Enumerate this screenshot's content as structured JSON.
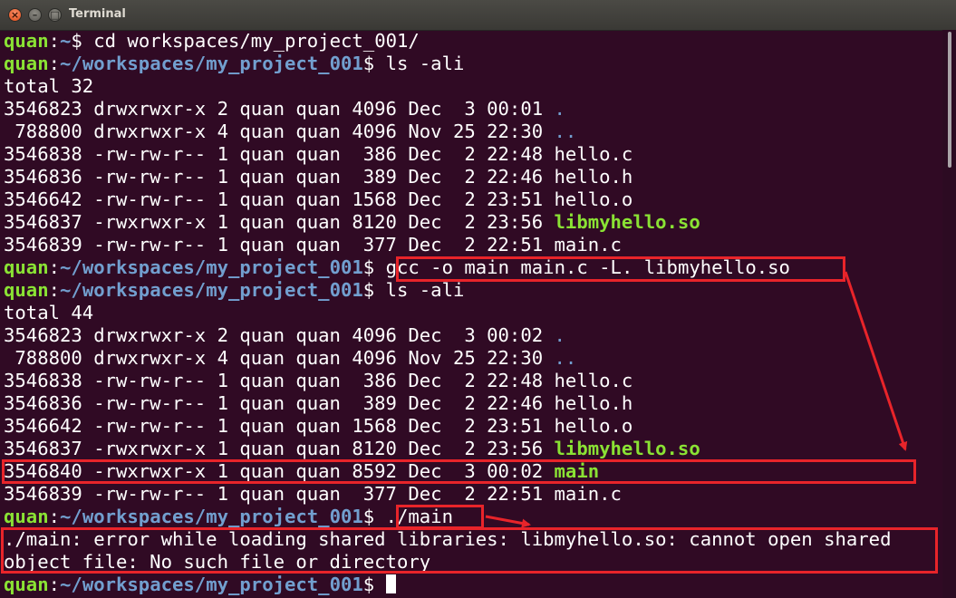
{
  "window": {
    "title": "Terminal"
  },
  "prompt": {
    "user": "quan",
    "sep": ":",
    "home_path": "~",
    "project_path": "~/workspaces/my_project_001",
    "symbol": "$"
  },
  "lines": [
    {
      "kind": "cmd",
      "path": "~",
      "command": " cd workspaces/my_project_001/"
    },
    {
      "kind": "cmd",
      "path": "~/workspaces/my_project_001",
      "command": " ls -ali"
    },
    {
      "kind": "out",
      "text": "total 32"
    },
    {
      "kind": "ls",
      "meta": "3546823 drwxrwxr-x 2 quan quan 4096 Dec  3 00:01 ",
      "name": ".",
      "style": "dir"
    },
    {
      "kind": "ls",
      "meta": " 788800 drwxrwxr-x 4 quan quan 4096 Nov 25 22:30 ",
      "name": "..",
      "style": "dir"
    },
    {
      "kind": "ls",
      "meta": "3546838 -rw-rw-r-- 1 quan quan  386 Dec  2 22:48 ",
      "name": "hello.c",
      "style": "file"
    },
    {
      "kind": "ls",
      "meta": "3546836 -rw-rw-r-- 1 quan quan  389 Dec  2 22:46 ",
      "name": "hello.h",
      "style": "file"
    },
    {
      "kind": "ls",
      "meta": "3546642 -rw-rw-r-- 1 quan quan 1568 Dec  2 23:51 ",
      "name": "hello.o",
      "style": "file"
    },
    {
      "kind": "ls",
      "meta": "3546837 -rwxrwxr-x 1 quan quan 8120 Dec  2 23:56 ",
      "name": "libmyhello.so",
      "style": "exe"
    },
    {
      "kind": "ls",
      "meta": "3546839 -rw-rw-r-- 1 quan quan  377 Dec  2 22:51 ",
      "name": "main.c",
      "style": "file"
    },
    {
      "kind": "cmd",
      "path": "~/workspaces/my_project_001",
      "command": " gcc -o main main.c -L. libmyhello.so"
    },
    {
      "kind": "cmd",
      "path": "~/workspaces/my_project_001",
      "command": " ls -ali"
    },
    {
      "kind": "out",
      "text": "total 44"
    },
    {
      "kind": "ls",
      "meta": "3546823 drwxrwxr-x 2 quan quan 4096 Dec  3 00:02 ",
      "name": ".",
      "style": "dir"
    },
    {
      "kind": "ls",
      "meta": " 788800 drwxrwxr-x 4 quan quan 4096 Nov 25 22:30 ",
      "name": "..",
      "style": "dir"
    },
    {
      "kind": "ls",
      "meta": "3546838 -rw-rw-r-- 1 quan quan  386 Dec  2 22:48 ",
      "name": "hello.c",
      "style": "file"
    },
    {
      "kind": "ls",
      "meta": "3546836 -rw-rw-r-- 1 quan quan  389 Dec  2 22:46 ",
      "name": "hello.h",
      "style": "file"
    },
    {
      "kind": "ls",
      "meta": "3546642 -rw-rw-r-- 1 quan quan 1568 Dec  2 23:51 ",
      "name": "hello.o",
      "style": "file"
    },
    {
      "kind": "ls",
      "meta": "3546837 -rwxrwxr-x 1 quan quan 8120 Dec  2 23:56 ",
      "name": "libmyhello.so",
      "style": "exe"
    },
    {
      "kind": "ls",
      "meta": "3546840 -rwxrwxr-x 1 quan quan 8592 Dec  3 00:02 ",
      "name": "main",
      "style": "exe"
    },
    {
      "kind": "ls",
      "meta": "3546839 -rw-rw-r-- 1 quan quan  377 Dec  2 22:51 ",
      "name": "main.c",
      "style": "file"
    },
    {
      "kind": "cmd",
      "path": "~/workspaces/my_project_001",
      "command": " ./main"
    },
    {
      "kind": "out",
      "text": "./main: error while loading shared libraries: libmyhello.so: cannot open shared"
    },
    {
      "kind": "out",
      "text": "object file: No such file or directory"
    },
    {
      "kind": "cmd",
      "path": "~/workspaces/my_project_001",
      "command": " ",
      "cursor": true
    }
  ],
  "colors": {
    "background": "#300a24",
    "prompt_user": "#8ae234",
    "prompt_path": "#729fcf",
    "executable": "#8ae234",
    "directory": "#729fcf",
    "annotation": "#e8242a"
  },
  "icons": {
    "close": "close-icon",
    "minimize": "minimize-icon",
    "maximize": "maximize-icon"
  }
}
